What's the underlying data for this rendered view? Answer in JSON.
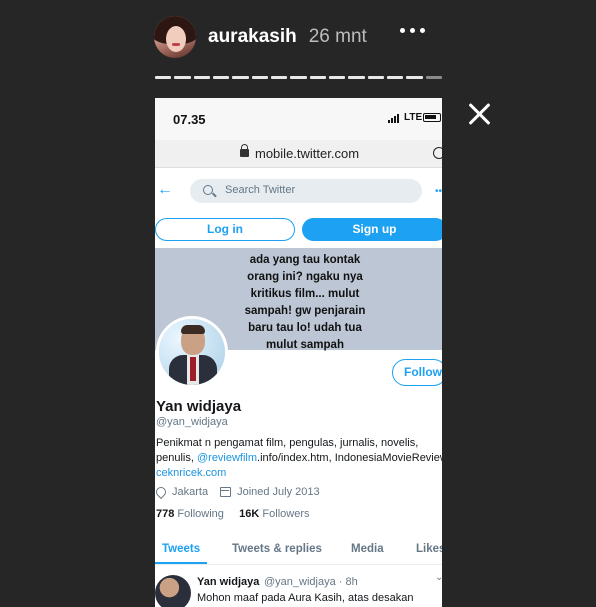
{
  "story": {
    "username": "aurakasih",
    "time_ago": "26 mnt",
    "progress_segments": 15,
    "current_segment": 15
  },
  "phone": {
    "status": {
      "time": "07.35",
      "network": "LTE"
    },
    "browser": {
      "url": "mobile.twitter.com"
    },
    "search": {
      "placeholder": "Search Twitter"
    },
    "buttons": {
      "login": "Log in",
      "signup": "Sign up",
      "follow": "Follow"
    },
    "banner_lines": [
      "ada yang tau kontak",
      "orang ini? ngaku nya",
      "kritikus film... mulut",
      "sampah! gw penjarain",
      "baru tau lo! udah tua",
      "mulut sampah"
    ],
    "profile": {
      "name": "Yan widjaya",
      "handle": "@yan_widjaya",
      "bio_line1": "Penikmat n pengamat film, pengulas, jurnalis,  novelis,",
      "bio_line2_prefix": "penulis, ",
      "bio_link": "@reviewfilm",
      "bio_line2_suffix": ".info/index.htm, IndonesiaMovieReview",
      "bio_line3": "ceknricek.com",
      "location": "Jakarta",
      "joined": "Joined July 2013",
      "following_count": "778",
      "following_label": "Following",
      "followers_count": "16K",
      "followers_label": "Followers"
    },
    "tabs": [
      "Tweets",
      "Tweets & replies",
      "Media",
      "Likes"
    ],
    "tweet": {
      "name": "Yan widjaya",
      "handle_time": "@yan_widjaya · 8h",
      "text": "Mohon maaf pada Aura Kasih, atas desakan"
    }
  },
  "colors": {
    "accent": "#1da1f2",
    "banner": "#bcc6d4",
    "background": "#262626"
  }
}
